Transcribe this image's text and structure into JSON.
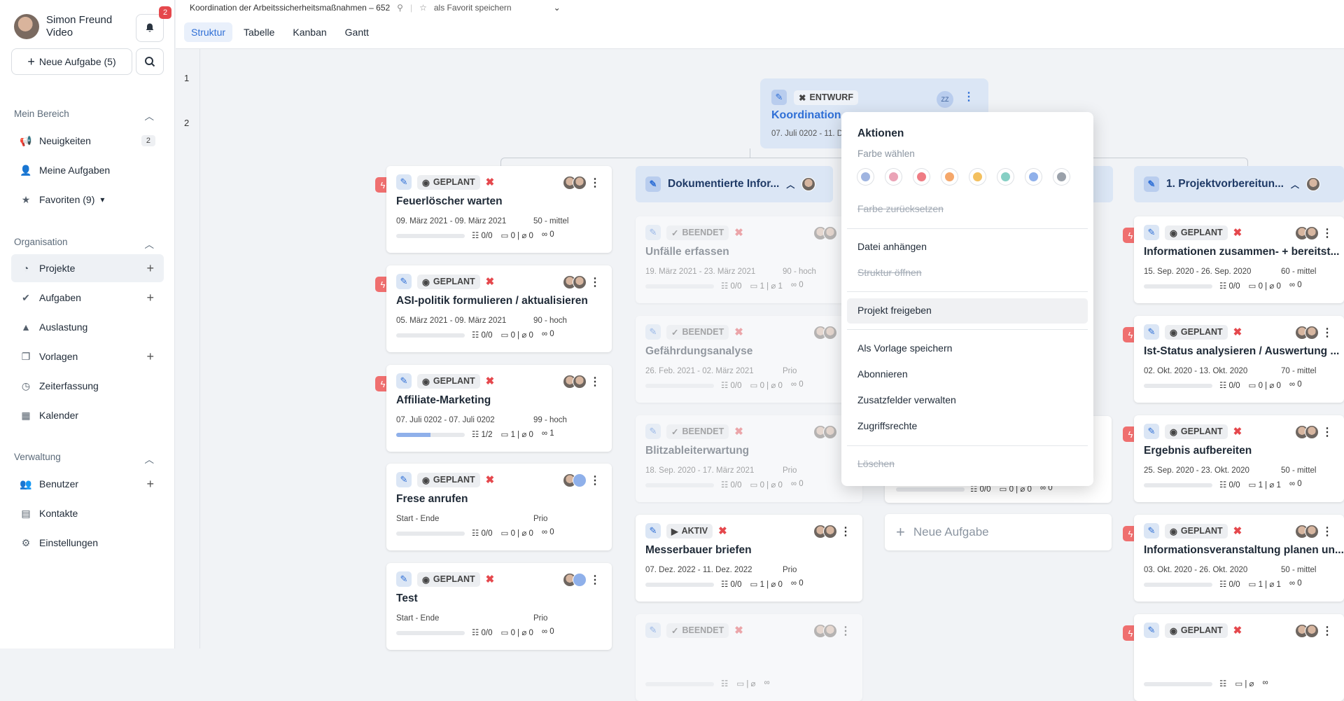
{
  "sidebar": {
    "user_name": "Simon Freund",
    "user_sub": "Video",
    "notif_count": "2",
    "new_task": "Neue Aufgabe (5)",
    "sections": {
      "mine": "Mein Bereich",
      "org": "Organisation",
      "admin": "Verwaltung"
    },
    "items": [
      {
        "label": "Neuigkeiten",
        "count": "2"
      },
      {
        "label": "Meine Aufgaben"
      },
      {
        "label": "Favoriten (9)"
      },
      {
        "label": "Projekte"
      },
      {
        "label": "Aufgaben"
      },
      {
        "label": "Auslastung"
      },
      {
        "label": "Vorlagen"
      },
      {
        "label": "Zeiterfassung"
      },
      {
        "label": "Kalender"
      },
      {
        "label": "Benutzer"
      },
      {
        "label": "Kontakte"
      },
      {
        "label": "Einstellungen"
      }
    ]
  },
  "header": {
    "project_title": "Koordination der Arbeitssicherheitsmaßnahmen – 652",
    "favorite": "als Favorit speichern",
    "tabs": [
      "Struktur",
      "Tabelle",
      "Kanban",
      "Gantt"
    ]
  },
  "rows": [
    "1",
    "2"
  ],
  "root": {
    "status": "ENTWURF",
    "title": "Koordination",
    "dates": "07. Juli 0202 - 11. D",
    "initials": "ZZ"
  },
  "columns": [
    {
      "title": "Dokumentierte Infor..."
    },
    {
      "title": "1. Projektvorbereitun..."
    }
  ],
  "cards": [
    {
      "status": "GEPLANT",
      "title": "Feuerlöscher warten",
      "dates": "09. März 2021 - 09. März 2021",
      "prio": "50 - mittel",
      "checks": "0/0",
      "comments": "0",
      "attach": "0",
      "links": "0"
    },
    {
      "status": "GEPLANT",
      "title": "ASI-politik formulieren / aktualisieren",
      "dates": "05. März 2021 - 09. März 2021",
      "prio": "90 - hoch",
      "checks": "0/0",
      "comments": "0",
      "attach": "0",
      "links": "0"
    },
    {
      "status": "GEPLANT",
      "title": "Affiliate-Marketing",
      "dates": "07. Juli 0202 - 07. Juli 0202",
      "prio": "99 - hoch",
      "checks": "1/2",
      "comments": "1",
      "attach": "0",
      "links": "1"
    },
    {
      "status": "GEPLANT",
      "title": "Frese anrufen",
      "dates": "Start - Ende",
      "prio": "Prio",
      "checks": "0/0",
      "comments": "0",
      "attach": "0",
      "links": "0"
    },
    {
      "status": "GEPLANT",
      "title": "Test",
      "dates": "Start - Ende",
      "prio": "Prio",
      "checks": "0/0",
      "comments": "0",
      "attach": "0",
      "links": "0"
    },
    {
      "status": "BEENDET",
      "title": "Unfälle erfassen",
      "dates": "19. März 2021 - 23. März 2021",
      "prio": "90 - hoch",
      "checks": "0/0",
      "comments": "1",
      "attach": "1",
      "links": "0"
    },
    {
      "status": "BEENDET",
      "title": "Gefährdungsanalyse",
      "dates": "26. Feb. 2021 - 02. März 2021",
      "prio": "Prio",
      "checks": "0/0",
      "comments": "0",
      "attach": "0",
      "links": "0"
    },
    {
      "status": "BEENDET",
      "title": "Blitzableiterwartung",
      "dates": "18. Sep. 2020 - 17. März 2021",
      "prio": "Prio",
      "checks": "0/0",
      "comments": "0",
      "attach": "0",
      "links": "0"
    },
    {
      "status": "AKTIV",
      "title": "Messerbauer briefen",
      "dates": "07. Dez. 2022 - 11. Dez. 2022",
      "prio": "Prio",
      "checks": "0/0",
      "comments": "1",
      "attach": "0",
      "links": "0"
    },
    {
      "status": "BEENDET",
      "title": "",
      "dates": "",
      "prio": "",
      "checks": "",
      "comments": "",
      "attach": "",
      "links": ""
    },
    {
      "status": "GEPLANT",
      "title": "Informationen zusammen- + bereitst...",
      "dates": "15. Sep. 2020 - 26. Sep. 2020",
      "prio": "60 - mittel",
      "checks": "0/0",
      "comments": "0",
      "attach": "0",
      "links": "0"
    },
    {
      "status": "GEPLANT",
      "title": "Ist-Status analysieren / Auswertung ...",
      "dates": "02. Okt. 2020 - 13. Okt. 2020",
      "prio": "70 - mittel",
      "checks": "0/0",
      "comments": "0",
      "attach": "0",
      "links": "0"
    },
    {
      "status": "GEPLANT",
      "title": "Ergebnis aufbereiten",
      "dates": "25. Sep. 2020 - 23. Okt. 2020",
      "prio": "50 - mittel",
      "checks": "0/0",
      "comments": "1",
      "attach": "1",
      "links": "0"
    },
    {
      "status": "GEPLANT",
      "title": "Informationsveranstaltung planen un...",
      "dates": "03. Okt. 2020 - 26. Okt. 2020",
      "prio": "50 - mittel",
      "checks": "0/0",
      "comments": "1",
      "attach": "1",
      "links": "0"
    },
    {
      "status": "GEPLANT",
      "title": "",
      "dates": "",
      "prio": "",
      "checks": "",
      "comments": "",
      "attach": "",
      "links": ""
    }
  ],
  "column3_partial": {
    "checks": "0/0",
    "comments": "0",
    "attach": "0",
    "links": "0"
  },
  "new_card": "Neue Aufgabe",
  "menu": {
    "title": "Aktionen",
    "color_label": "Farbe wählen",
    "colors": [
      "#9fb4e0",
      "#eaa3b6",
      "#ef7c84",
      "#f5a76a",
      "#f3c05f",
      "#86cfc4",
      "#8fb0ea",
      "#9aa1aa"
    ],
    "reset": "Farbe zurücksetzen",
    "attach": "Datei anhängen",
    "open_structure": "Struktur öffnen",
    "share": "Projekt freigeben",
    "save_template": "Als Vorlage speichern",
    "subscribe": "Abonnieren",
    "extra_fields": "Zusatzfelder verwalten",
    "access": "Zugriffsrechte",
    "delete": "Löschen"
  }
}
